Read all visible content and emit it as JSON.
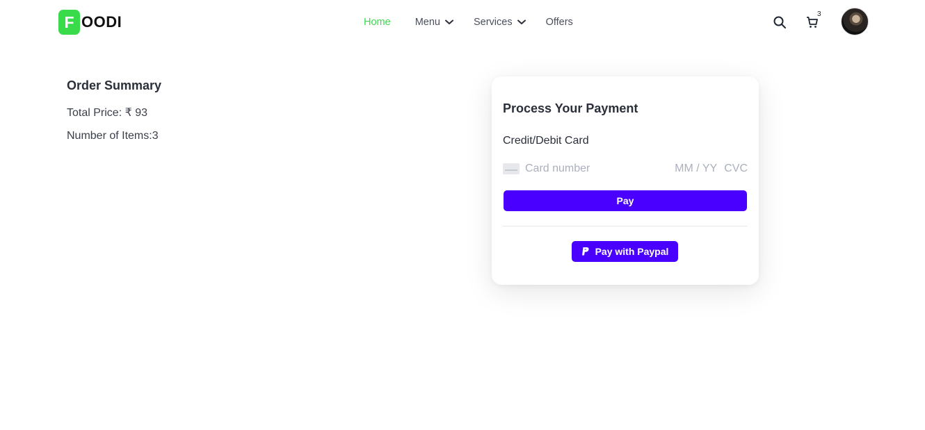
{
  "brand": {
    "badge": "F",
    "name": "OODI",
    "accent": "#39db4a"
  },
  "nav": {
    "home": "Home",
    "menu": "Menu",
    "services": "Services",
    "offers": "Offers"
  },
  "header": {
    "cart_count": "3",
    "icons": [
      "search-icon",
      "cart-icon",
      "avatar"
    ]
  },
  "summary": {
    "title": "Order Summary",
    "total_price": "Total Price: ₹ 93",
    "num_items": "Number of Items:3"
  },
  "payment": {
    "title": "Process Your Payment",
    "card_label": "Credit/Debit Card",
    "card_number_placeholder": "Card number",
    "expiry_placeholder": "MM / YY",
    "cvc_placeholder": "CVC",
    "pay_label": "Pay",
    "paypal_label": "Pay with Paypal",
    "button_color": "#4a00ff"
  }
}
